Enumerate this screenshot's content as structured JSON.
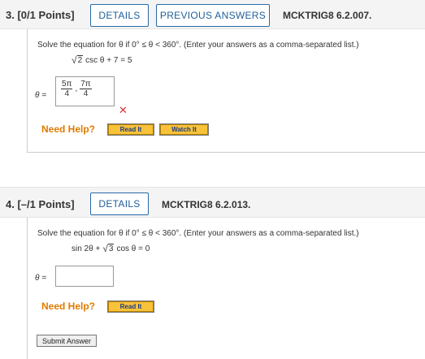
{
  "questions": [
    {
      "label": "3. [0/1 Points]",
      "details_label": "DETAILS",
      "previous_answers_label": "PREVIOUS ANSWERS",
      "code": "MCKTRIG8 6.2.007.",
      "instruction": "Solve the equation for θ if 0° ≤ θ < 360°. (Enter your answers as a comma-separated list.)",
      "equation": {
        "radicand": "2",
        "rest": "csc θ + 7 = 5"
      },
      "answer_label": "θ =",
      "answer": {
        "frac1_num": "5π",
        "frac1_den": "4",
        "separator": ",",
        "frac2_num": "7π",
        "frac2_den": "4"
      },
      "status_icon": "incorrect-x-icon",
      "need_help": "Need Help?",
      "read_it": "Read It",
      "watch_it": "Watch It"
    },
    {
      "label": "4. [–/1 Points]",
      "details_label": "DETAILS",
      "code": "MCKTRIG8 6.2.013.",
      "instruction": "Solve the equation for θ if 0° ≤ θ < 360°. (Enter your answers as a comma-separated list.)",
      "equation": {
        "prefix": "sin 2θ +",
        "radicand": "3",
        "rest": "cos θ = 0"
      },
      "answer_label": "θ =",
      "answer_value": "",
      "need_help": "Need Help?",
      "read_it": "Read It",
      "submit": "Submit Answer"
    }
  ],
  "colors": {
    "accent": "#1f5f99",
    "help": "#e07b00",
    "error": "#d03030",
    "button": "#f8c23a"
  }
}
